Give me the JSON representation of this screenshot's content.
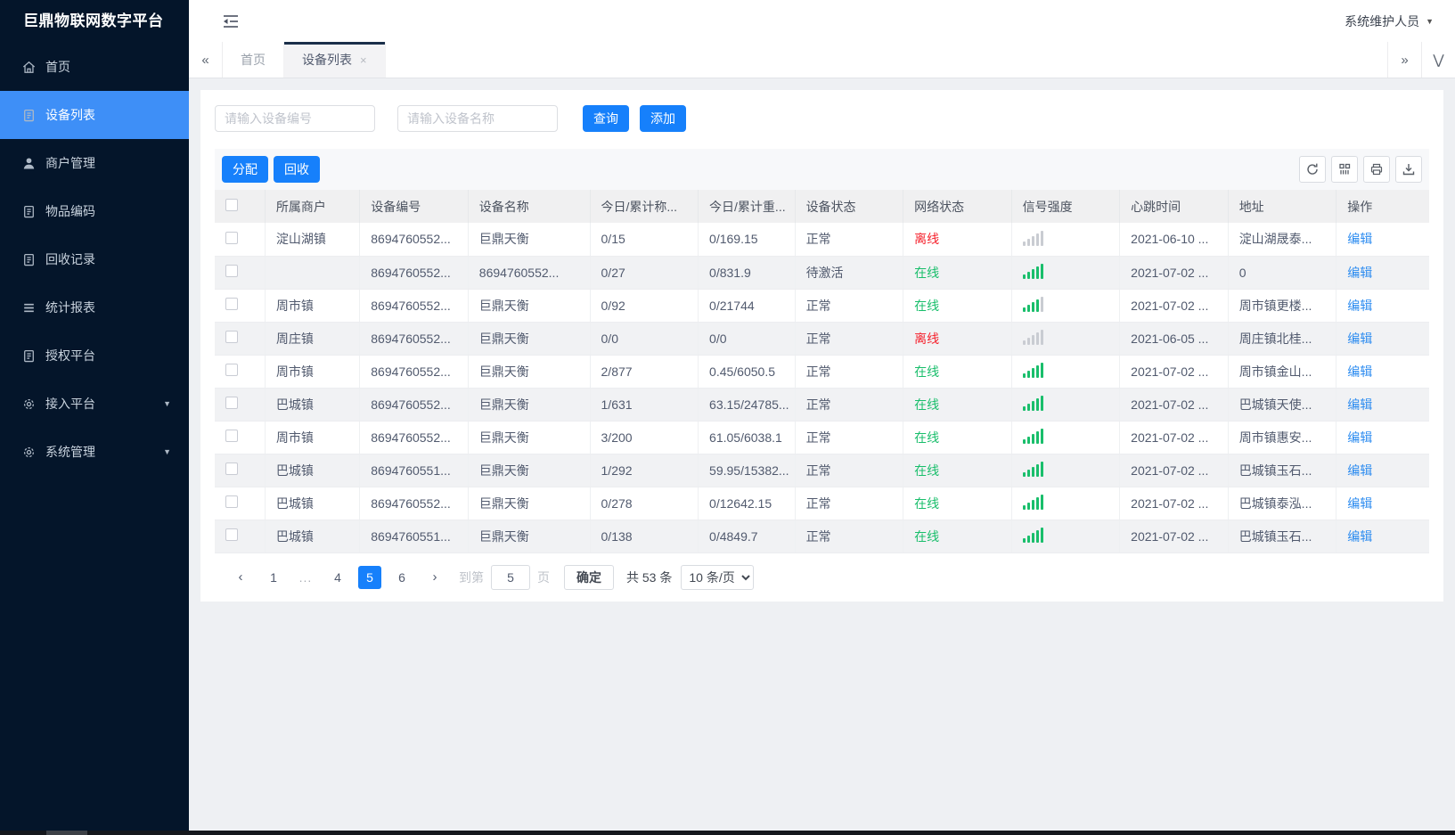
{
  "app": {
    "title": "巨鼎物联网数字平台",
    "user": "系统维护人员"
  },
  "sidebar": {
    "items": [
      {
        "id": "home",
        "label": "首页",
        "icon": "home",
        "active": false,
        "caret": false
      },
      {
        "id": "device-list",
        "label": "设备列表",
        "icon": "document",
        "active": true,
        "caret": false
      },
      {
        "id": "merchant-management",
        "label": "商户管理",
        "icon": "user",
        "active": false,
        "caret": false
      },
      {
        "id": "item-coding",
        "label": "物品编码",
        "icon": "document",
        "active": false,
        "caret": false
      },
      {
        "id": "recycle-records",
        "label": "回收记录",
        "icon": "document",
        "active": false,
        "caret": false
      },
      {
        "id": "statistics-report",
        "label": "统计报表",
        "icon": "list",
        "active": false,
        "caret": false
      },
      {
        "id": "authorization-platform",
        "label": "授权平台",
        "icon": "document",
        "active": false,
        "caret": false
      },
      {
        "id": "access-platform",
        "label": "接入平台",
        "icon": "gear",
        "active": false,
        "caret": true
      },
      {
        "id": "system-management",
        "label": "系统管理",
        "icon": "gear",
        "active": false,
        "caret": true
      }
    ]
  },
  "tabs": {
    "items": [
      {
        "id": "home",
        "label": "首页",
        "active": false,
        "closable": false
      },
      {
        "id": "device-list",
        "label": "设备列表",
        "active": true,
        "closable": true
      }
    ]
  },
  "search": {
    "device_no_placeholder": "请输入设备编号",
    "device_name_placeholder": "请输入设备名称",
    "query_label": "查询",
    "add_label": "添加"
  },
  "toolbar": {
    "assign_label": "分配",
    "recycle_label": "回收"
  },
  "table": {
    "headers": [
      "所属商户",
      "设备编号",
      "设备名称",
      "今日/累计称...",
      "今日/累计重...",
      "设备状态",
      "网络状态",
      "信号强度",
      "心跳时间",
      "地址",
      "操作"
    ],
    "rows": [
      {
        "merchant": "淀山湖镇",
        "device_no": "8694760552...",
        "device_name": "巨鼎天衡",
        "today_total_count": "0/15",
        "today_total_weight": "0/169.15",
        "device_status": "正常",
        "network_status": "离线",
        "online": false,
        "signal_level": 0,
        "heartbeat": "2021-06-10 ...",
        "address": "淀山湖晟泰...",
        "action": "编辑"
      },
      {
        "merchant": "",
        "device_no": "8694760552...",
        "device_name": "8694760552...",
        "today_total_count": "0/27",
        "today_total_weight": "0/831.9",
        "device_status": "待激活",
        "network_status": "在线",
        "online": true,
        "signal_level": 5,
        "heartbeat": "2021-07-02 ...",
        "address": "0",
        "action": "编辑"
      },
      {
        "merchant": "周市镇",
        "device_no": "8694760552...",
        "device_name": "巨鼎天衡",
        "today_total_count": "0/92",
        "today_total_weight": "0/21744",
        "device_status": "正常",
        "network_status": "在线",
        "online": true,
        "signal_level": 4,
        "heartbeat": "2021-07-02 ...",
        "address": "周市镇更楼...",
        "action": "编辑"
      },
      {
        "merchant": "周庄镇",
        "device_no": "8694760552...",
        "device_name": "巨鼎天衡",
        "today_total_count": "0/0",
        "today_total_weight": "0/0",
        "device_status": "正常",
        "network_status": "离线",
        "online": false,
        "signal_level": 0,
        "heartbeat": "2021-06-05 ...",
        "address": "周庄镇北桂...",
        "action": "编辑"
      },
      {
        "merchant": "周市镇",
        "device_no": "8694760552...",
        "device_name": "巨鼎天衡",
        "today_total_count": "2/877",
        "today_total_weight": "0.45/6050.5",
        "device_status": "正常",
        "network_status": "在线",
        "online": true,
        "signal_level": 5,
        "heartbeat": "2021-07-02 ...",
        "address": "周市镇金山...",
        "action": "编辑"
      },
      {
        "merchant": "巴城镇",
        "device_no": "8694760552...",
        "device_name": "巨鼎天衡",
        "today_total_count": "1/631",
        "today_total_weight": "63.15/24785...",
        "device_status": "正常",
        "network_status": "在线",
        "online": true,
        "signal_level": 5,
        "heartbeat": "2021-07-02 ...",
        "address": "巴城镇天使...",
        "action": "编辑"
      },
      {
        "merchant": "周市镇",
        "device_no": "8694760552...",
        "device_name": "巨鼎天衡",
        "today_total_count": "3/200",
        "today_total_weight": "61.05/6038.1",
        "device_status": "正常",
        "network_status": "在线",
        "online": true,
        "signal_level": 5,
        "heartbeat": "2021-07-02 ...",
        "address": "周市镇惠安...",
        "action": "编辑"
      },
      {
        "merchant": "巴城镇",
        "device_no": "8694760551...",
        "device_name": "巨鼎天衡",
        "today_total_count": "1/292",
        "today_total_weight": "59.95/15382...",
        "device_status": "正常",
        "network_status": "在线",
        "online": true,
        "signal_level": 5,
        "heartbeat": "2021-07-02 ...",
        "address": "巴城镇玉石...",
        "action": "编辑"
      },
      {
        "merchant": "巴城镇",
        "device_no": "8694760552...",
        "device_name": "巨鼎天衡",
        "today_total_count": "0/278",
        "today_total_weight": "0/12642.15",
        "device_status": "正常",
        "network_status": "在线",
        "online": true,
        "signal_level": 5,
        "heartbeat": "2021-07-02 ...",
        "address": "巴城镇泰泓...",
        "action": "编辑"
      },
      {
        "merchant": "巴城镇",
        "device_no": "8694760551...",
        "device_name": "巨鼎天衡",
        "today_total_count": "0/138",
        "today_total_weight": "0/4849.7",
        "device_status": "正常",
        "network_status": "在线",
        "online": true,
        "signal_level": 5,
        "heartbeat": "2021-07-02 ...",
        "address": "巴城镇玉石...",
        "action": "编辑"
      }
    ]
  },
  "pagination": {
    "pages": [
      "1",
      "...",
      "4",
      "5",
      "6"
    ],
    "active_page": "5",
    "jump_label": "到第",
    "jump_value": "5",
    "jump_unit": "页",
    "confirm_label": "确定",
    "total_label": "共 53 条",
    "page_size_label": "10 条/页"
  },
  "colors": {
    "primary": "#1680fb",
    "sidebar_bg": "#04152a",
    "sidebar_active": "#3e8ff7",
    "success": "#19be6b",
    "danger": "#f5222d",
    "link": "#2d8cf0"
  }
}
